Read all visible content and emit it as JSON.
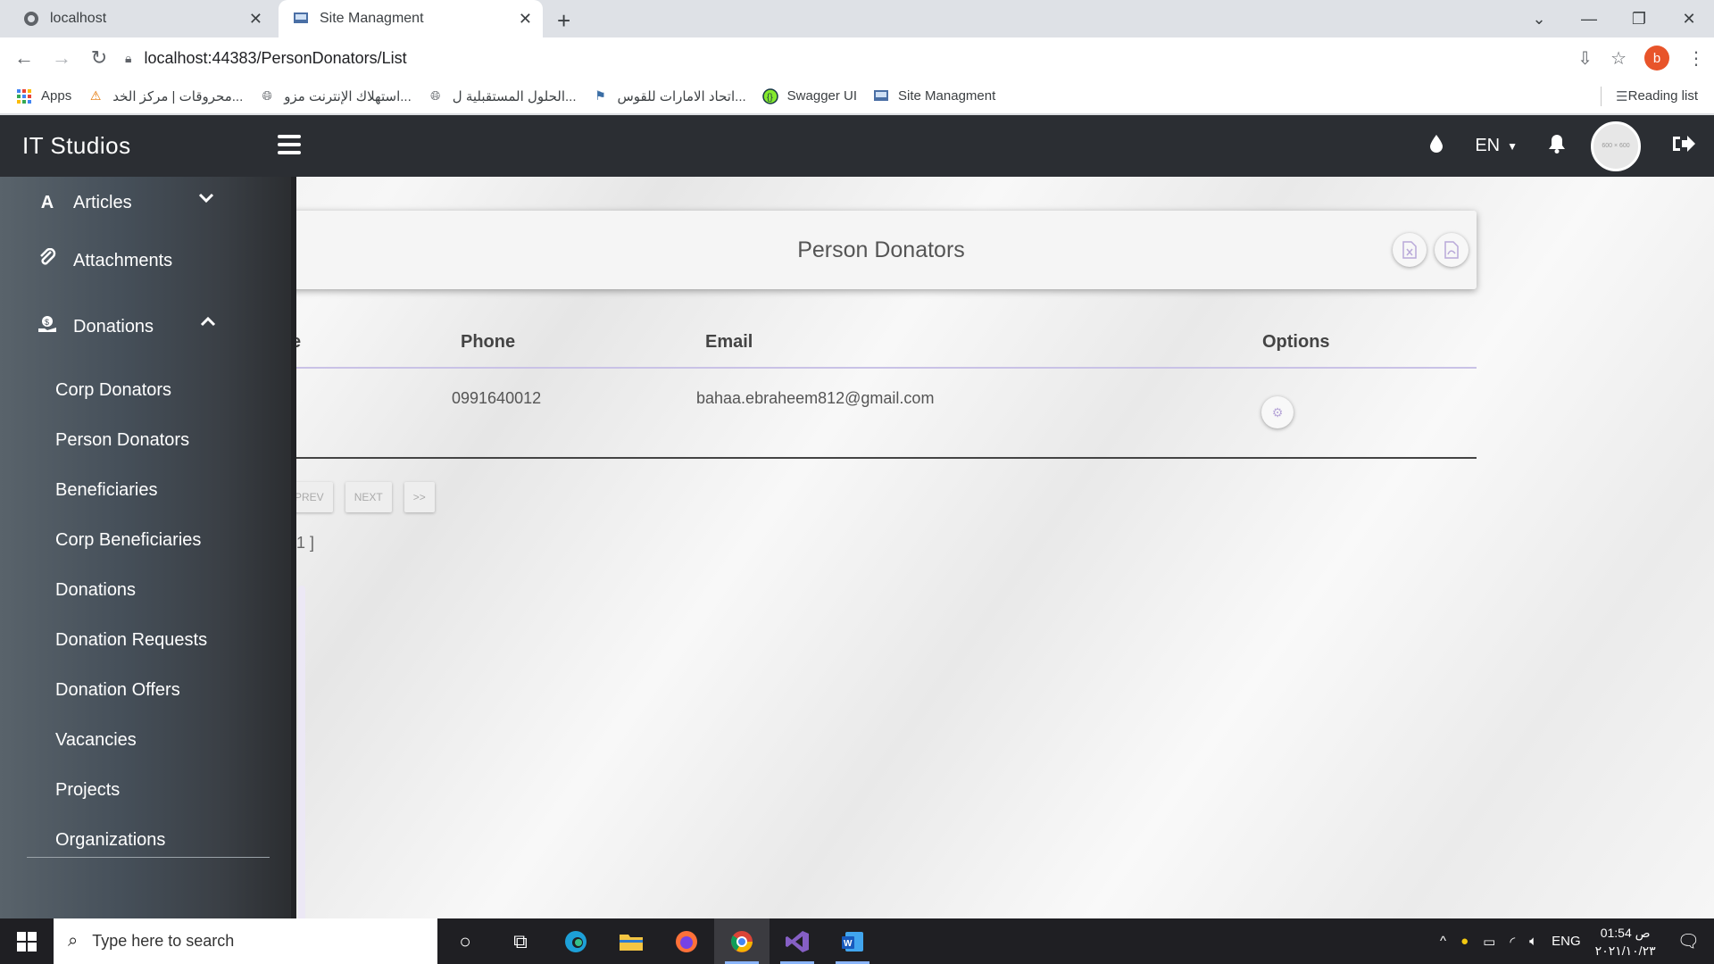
{
  "browser": {
    "tabs": [
      {
        "title": "localhost"
      },
      {
        "title": "Site Managment"
      }
    ],
    "url": "localhost:44383/PersonDonators/List",
    "profile_initial": "b",
    "bookmarks": [
      {
        "label": "Apps",
        "icon": "apps-grid-icon"
      },
      {
        "label": "محروقات | مركز الخد...",
        "icon": "warning-icon"
      },
      {
        "label": "استهلاك الإنترنت مزو...",
        "icon": "globe-icon"
      },
      {
        "label": "الحلول المستقبلية ل...",
        "icon": "globe-icon"
      },
      {
        "label": "اتحاد الامارات للقوس...",
        "icon": "flag-icon"
      },
      {
        "label": "Swagger UI",
        "icon": "swagger-icon"
      },
      {
        "label": "Site Managment",
        "icon": "site-icon"
      }
    ],
    "reading_list": "Reading list"
  },
  "header": {
    "brand": "IT Studios",
    "language": "EN",
    "avatar_text": "600 × 600"
  },
  "sidebar": {
    "top_items": [
      {
        "label": "Articles",
        "icon": "letter-a-icon",
        "expanded": false
      },
      {
        "label": "Attachments",
        "icon": "paperclip-icon"
      },
      {
        "label": "Donations",
        "icon": "donation-icon",
        "expanded": true
      }
    ],
    "sub_items": [
      {
        "label": "Corp Donators"
      },
      {
        "label": "Person Donators"
      },
      {
        "label": "Beneficiaries"
      },
      {
        "label": "Corp Beneficiaries"
      },
      {
        "label": "Donations"
      },
      {
        "label": "Donation Requests"
      },
      {
        "label": "Donation Offers"
      },
      {
        "label": "Vacancies"
      },
      {
        "label": "Projects"
      },
      {
        "label": "Organizations"
      }
    ]
  },
  "page": {
    "title": "Person Donators",
    "columns": {
      "name_partial": "e",
      "phone": "Phone",
      "email": "Email",
      "options": "Options"
    },
    "rows": [
      {
        "phone": "0991640012",
        "email": "bahaa.ebraheem812@gmail.com"
      }
    ],
    "pager": {
      "prev": "PREV",
      "next": "NEXT",
      "last": ">>"
    },
    "page_info": "1 ]"
  },
  "taskbar": {
    "search_placeholder": "Type here to search",
    "lang": "ENG",
    "time": "01:54 ص",
    "date": "٢٠٢١/١٠/٢٣"
  },
  "colors": {
    "header_bg": "#2b2e33",
    "accent_line": "#c9c2e6",
    "icon_tint": "#b9a9d9",
    "profile_badge": "#e8542a"
  }
}
